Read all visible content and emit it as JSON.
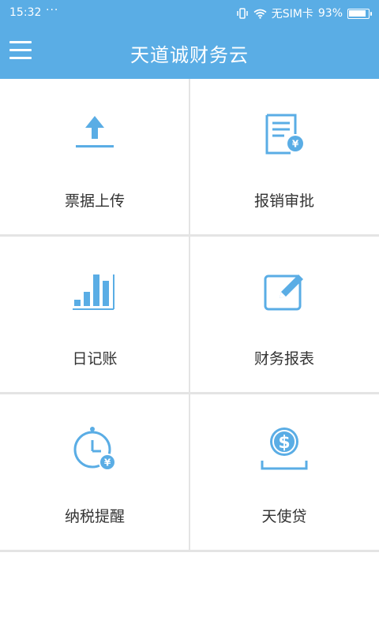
{
  "status": {
    "time": "15:32",
    "dots": "···",
    "carrier": "无SIM卡",
    "battery": "93%",
    "battery_level": 0.93
  },
  "header": {
    "title": "天道诚财务云",
    "menu_icon": "hamburger-icon"
  },
  "tiles": [
    {
      "label": "票据上传",
      "icon": "upload-icon"
    },
    {
      "label": "报销审批",
      "icon": "invoice-document-icon"
    },
    {
      "label": "日记账",
      "icon": "bar-chart-icon"
    },
    {
      "label": "财务报表",
      "icon": "edit-icon"
    },
    {
      "label": "纳税提醒",
      "icon": "clock-icon"
    },
    {
      "label": "天使贷",
      "icon": "money-coin-icon"
    }
  ],
  "colors": {
    "header_bg": "#5aade5",
    "icon": "#5aade5",
    "label": "#333333",
    "divider": "#e4e4e4"
  }
}
